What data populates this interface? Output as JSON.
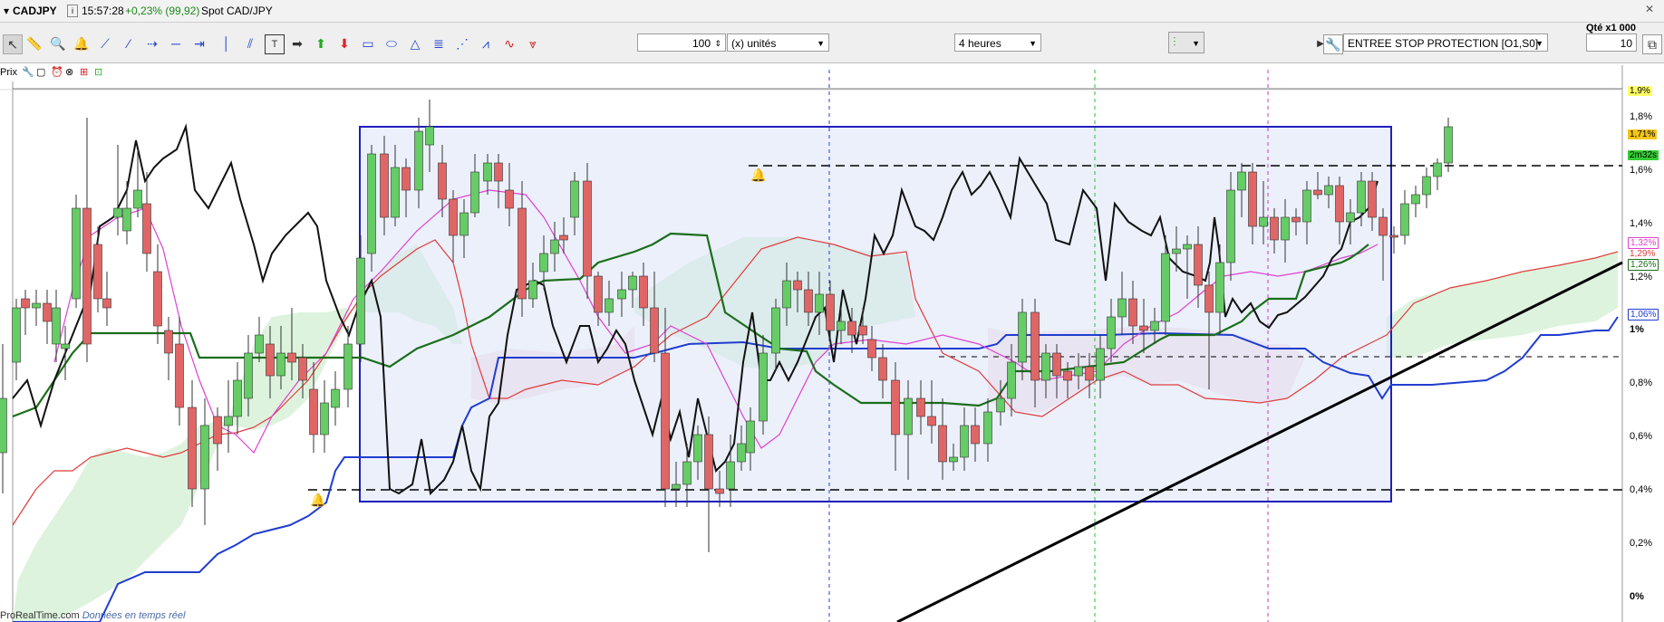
{
  "topbar": {
    "symbol": "CADJPY",
    "time": "15:57:28",
    "change": "+0,23% (99,92)",
    "instrument": "Spot CAD/JPY"
  },
  "toolbar": {
    "quantity_value": "100",
    "unit_select": "(x) unités",
    "timeframe_select": "4 heures",
    "strategy_select": "ENTREE STOP PROTECTION [O1,S0]",
    "qty_label": "Qté x1 000",
    "qty_value": "10"
  },
  "subbar": {
    "label": "Prix"
  },
  "price_axis": {
    "labels": [
      "1,8%",
      "1,6%",
      "1,4%",
      "1,2%",
      "1%",
      "0,8%",
      "0,6%",
      "0,4%",
      "0,2%",
      "0%"
    ]
  },
  "tags": {
    "t1": "1,9%",
    "t2": "1,71%",
    "t3": "2m32s",
    "t4": "1,32%",
    "t5": "1,29%",
    "t6": "1,26%",
    "t7": "1,06%"
  },
  "footer": {
    "brand": "ProRealTime.com",
    "note": "Données en temps réel"
  },
  "colors": {
    "up": "#66cc66",
    "down": "#e06666",
    "rect": "#1f1fbf",
    "kijun": "#1a6e1a"
  }
}
